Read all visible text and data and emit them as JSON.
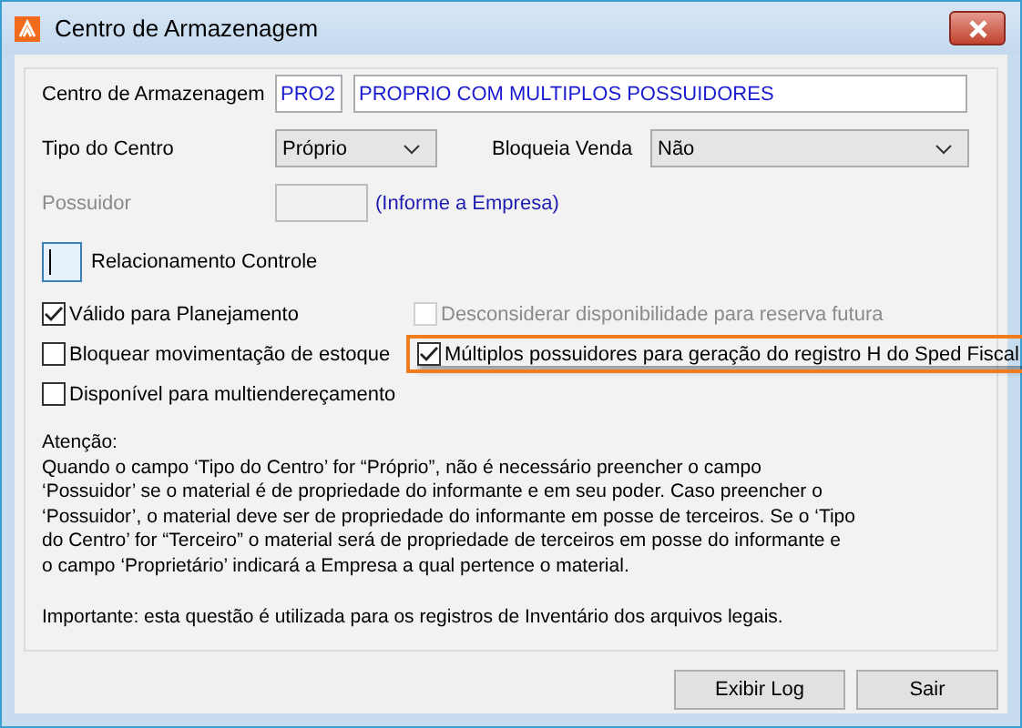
{
  "window": {
    "title": "Centro de Armazenagem"
  },
  "fields": {
    "centro_label": "Centro de Armazenagem",
    "centro_code": "PRO2",
    "centro_name": "PROPRIO COM MULTIPLOS POSSUIDORES",
    "tipo_label": "Tipo do Centro",
    "tipo_value": "Próprio",
    "bloqueia_label": "Bloqueia Venda",
    "bloqueia_value": "Não",
    "possuidor_label": "Possuidor",
    "possuidor_disabled": true,
    "possuidor_hint": "(Informe a Empresa)",
    "relacionamento_label": "Relacionamento Controle"
  },
  "checkboxes": [
    {
      "label": "Válido para Planejamento",
      "checked": true,
      "disabled": false,
      "highlighted": false
    },
    {
      "label": "Desconsiderar disponibilidade para reserva futura",
      "checked": false,
      "disabled": true,
      "highlighted": false
    },
    {
      "label": "Bloquear movimentação de estoque",
      "checked": false,
      "disabled": false,
      "highlighted": false
    },
    {
      "label": "Múltiplos possuidores para geração do registro H do Sped Fiscal",
      "checked": true,
      "disabled": false,
      "highlighted": true
    },
    {
      "label": "Disponível para multiendereçamento",
      "checked": false,
      "disabled": false,
      "highlighted": false
    }
  ],
  "notes": [
    "Atenção:\nQuando o campo ‘Tipo do Centro’ for “Próprio”, não é necessário preencher o campo\n‘Possuidor’ se o material é de propriedade do informante e em seu poder. Caso preencher o\n‘Possuidor’, o material deve ser de propriedade do informante em posse de terceiros. Se o ‘Tipo\ndo Centro’ for “Terceiro” o material será de propriedade de terceiros em posse do informante e\no campo ‘Proprietário’ indicará a Empresa a qual pertence o material.",
    "Importante: esta questão é utilizada para os registros de Inventário dos arquivos legais."
  ],
  "buttons": [
    "Exibir Log",
    "Sair"
  ]
}
